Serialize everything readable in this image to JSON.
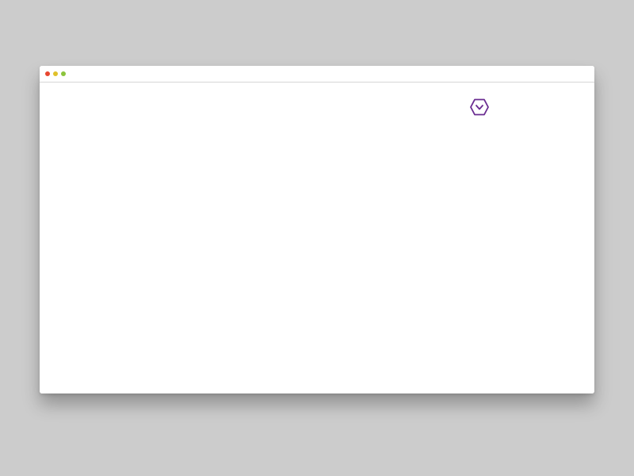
{
  "window": {
    "traffic_lights": [
      {
        "name": "close",
        "color": "#e8462f"
      },
      {
        "name": "minimize",
        "color": "#e0c12a"
      },
      {
        "name": "maximize",
        "color": "#8cc43c"
      }
    ],
    "background_color": "#ffffff"
  },
  "content": {
    "logo": {
      "icon": "hexagon-chevron-logo-icon",
      "color": "#6a2c91"
    }
  },
  "desktop": {
    "background_color": "#cccccc"
  }
}
